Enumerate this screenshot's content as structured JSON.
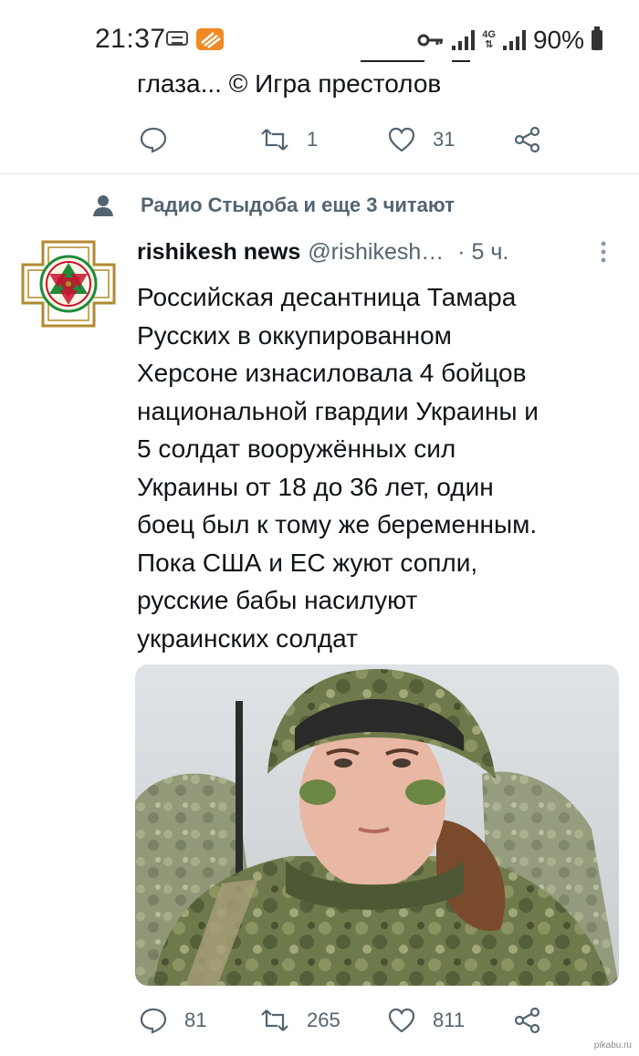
{
  "status_bar": {
    "time": "21:37",
    "battery": "90%",
    "network": "4G",
    "icons": [
      "vm-icon",
      "app-notification-icon",
      "key-icon",
      "signal-icon",
      "battery-icon"
    ]
  },
  "previous_tweet": {
    "text": "глаза... © Игра престолов",
    "replies": "",
    "retweets": "1",
    "likes": "31"
  },
  "social_context": {
    "text": "Радио Стыдоба и еще 3 читают"
  },
  "tweet": {
    "author": "rishikesh news",
    "handle": "@rishikesh…",
    "time": "· 5 ч.",
    "lines": [
      "Российская десантница Тамара",
      "Русских в оккупированном",
      "Херсоне изнасиловала 4 бойцов",
      "национальной гвардии Украины и",
      "5 солдат вооружённых сил",
      "Украины от 18 до 36 лет, один",
      "боец был к тому же беременным.",
      "Пока США и ЕС жуют сопли,",
      "русские бабы насилуют",
      "украинских солдат"
    ],
    "replies": "81",
    "retweets": "265",
    "likes": "811"
  },
  "watermark": "pikabu.ru",
  "colors": {
    "text": "#0f1419",
    "secondary": "#536471",
    "avatar_green": "#1e8b3a",
    "avatar_red": "#c8102e",
    "avatar_gold": "#b08a2e"
  }
}
